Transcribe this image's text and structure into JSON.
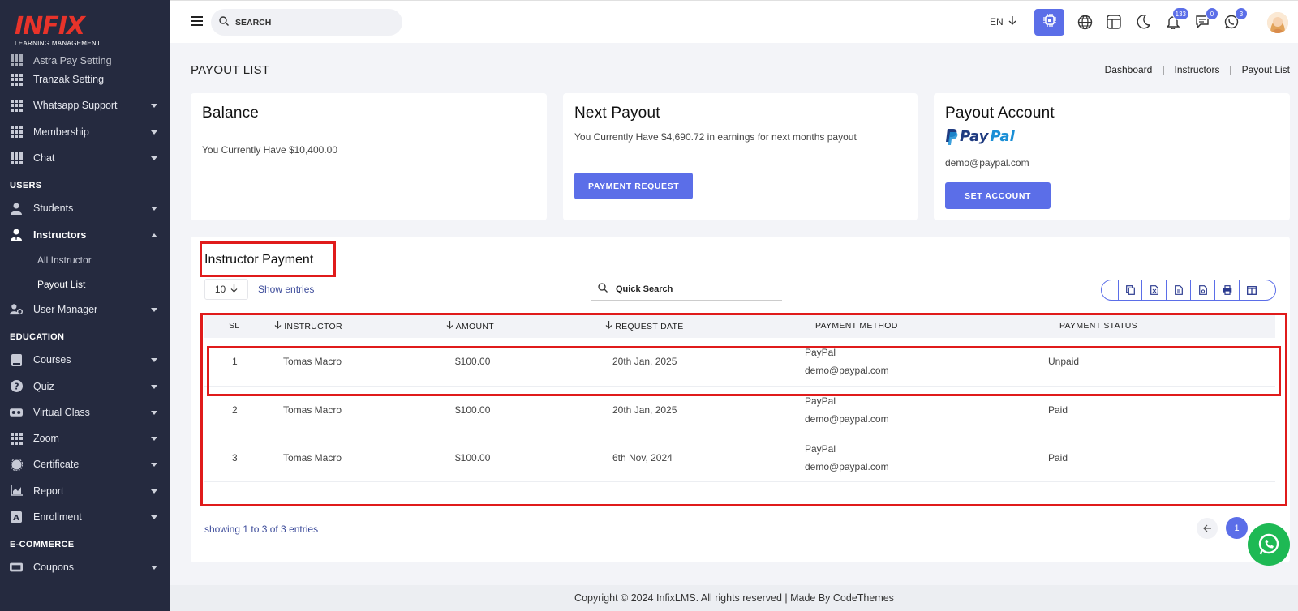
{
  "brand": {
    "logo_text": "INFIX",
    "logo_sub": "LEARNING MANAGEMENT",
    "logo_color": "#e8332a"
  },
  "colors": {
    "accent": "#5b6ee8",
    "sidebar_bg": "#252a3f",
    "whatsapp": "#1eb954",
    "annotation_red": "#e01b1b"
  },
  "sidebar": {
    "items_top": [
      {
        "label": "Astra Pay Setting",
        "icon": "grid-icon"
      },
      {
        "label": "Tranzak Setting",
        "icon": "grid-icon"
      },
      {
        "label": "Whatsapp Support",
        "icon": "grid-icon"
      },
      {
        "label": "Membership",
        "icon": "grid-icon"
      },
      {
        "label": "Chat",
        "icon": "grid-icon"
      }
    ],
    "section_users": "USERS",
    "users": [
      {
        "label": "Students",
        "icon": "user-icon"
      },
      {
        "label": "Instructors",
        "icon": "instructor-icon"
      }
    ],
    "instructors_sub": [
      "All Instructor",
      "Payout List"
    ],
    "user_manager": {
      "label": "User Manager",
      "icon": "user-gear-icon"
    },
    "section_education": "EDUCATION",
    "education": [
      {
        "label": "Courses",
        "icon": "book-icon"
      },
      {
        "label": "Quiz",
        "icon": "question-icon"
      },
      {
        "label": "Virtual Class",
        "icon": "vr-icon"
      },
      {
        "label": "Zoom",
        "icon": "grid-icon"
      },
      {
        "label": "Certificate",
        "icon": "certificate-icon"
      },
      {
        "label": "Report",
        "icon": "chart-icon"
      },
      {
        "label": "Enrollment",
        "icon": "enrollment-icon"
      }
    ],
    "section_ecommerce": "E-COMMERCE",
    "ecommerce": [
      {
        "label": "Coupons",
        "icon": "coupon-icon"
      }
    ]
  },
  "topbar": {
    "search_placeholder": "SEARCH",
    "language": "EN",
    "notifications_count": "133",
    "messages_count": "0",
    "whatsapp_count": "3"
  },
  "page": {
    "title": "PAYOUT LIST",
    "breadcrumb": [
      "Dashboard",
      "Instructors",
      "Payout List"
    ]
  },
  "cards": {
    "balance": {
      "title": "Balance",
      "text": "You Currently Have $10,400.00"
    },
    "next_payout": {
      "title": "Next Payout",
      "text": "You Currently Have $4,690.72 in earnings for next months payout",
      "button": "PAYMENT REQUEST"
    },
    "payout_account": {
      "title": "Payout Account",
      "logo_pay": "Pay",
      "logo_pal": "Pal",
      "email": "demo@paypal.com",
      "button": "SET ACCOUNT"
    }
  },
  "instructor_payment": {
    "title": "Instructor Payment",
    "entries_value": "10",
    "entries_label": "Show entries",
    "quick_search_placeholder": "Quick Search",
    "columns": [
      "SL",
      "INSTRUCTOR",
      "AMOUNT",
      "REQUEST DATE",
      "PAYMENT METHOD",
      "PAYMENT STATUS"
    ],
    "rows": [
      {
        "sl": "1",
        "instructor": "Tomas Macro",
        "amount": "$100.00",
        "date": "20th Jan, 2025",
        "method": "PayPal",
        "method_email": "demo@paypal.com",
        "status": "Unpaid"
      },
      {
        "sl": "2",
        "instructor": "Tomas Macro",
        "amount": "$100.00",
        "date": "20th Jan, 2025",
        "method": "PayPal",
        "method_email": "demo@paypal.com",
        "status": "Paid"
      },
      {
        "sl": "3",
        "instructor": "Tomas Macro",
        "amount": "$100.00",
        "date": "6th Nov, 2024",
        "method": "PayPal",
        "method_email": "demo@paypal.com",
        "status": "Paid"
      }
    ],
    "showing_text": "showing 1 to 3 of 3 entries",
    "current_page": "1"
  },
  "footer": {
    "text": "Copyright © 2024 InfixLMS. All rights reserved | Made By CodeThemes"
  }
}
